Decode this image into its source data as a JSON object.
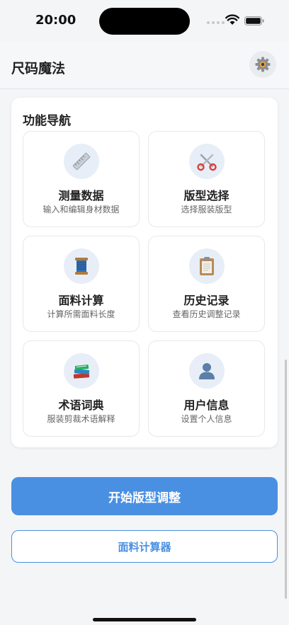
{
  "status_bar": {
    "time": "20:00"
  },
  "header": {
    "title": "尺码魔法",
    "settings_icon": "gear-icon"
  },
  "nav": {
    "title": "功能导航",
    "items": [
      {
        "label": "测量数据",
        "desc": "输入和编辑身材数据",
        "icon": "ruler-icon"
      },
      {
        "label": "版型选择",
        "desc": "选择服装版型",
        "icon": "scissors-icon"
      },
      {
        "label": "面料计算",
        "desc": "计算所需面料长度",
        "icon": "thread-spool-icon"
      },
      {
        "label": "历史记录",
        "desc": "查看历史调整记录",
        "icon": "clipboard-icon"
      },
      {
        "label": "术语词典",
        "desc": "服装剪裁术语解释",
        "icon": "books-icon"
      },
      {
        "label": "用户信息",
        "desc": "设置个人信息",
        "icon": "user-icon"
      }
    ]
  },
  "actions": {
    "primary_label": "开始版型调整",
    "secondary_label": "面料计算器"
  },
  "colors": {
    "accent": "#4a90e2",
    "icon_bg": "#e8eef7",
    "background": "#f4f5f7"
  }
}
